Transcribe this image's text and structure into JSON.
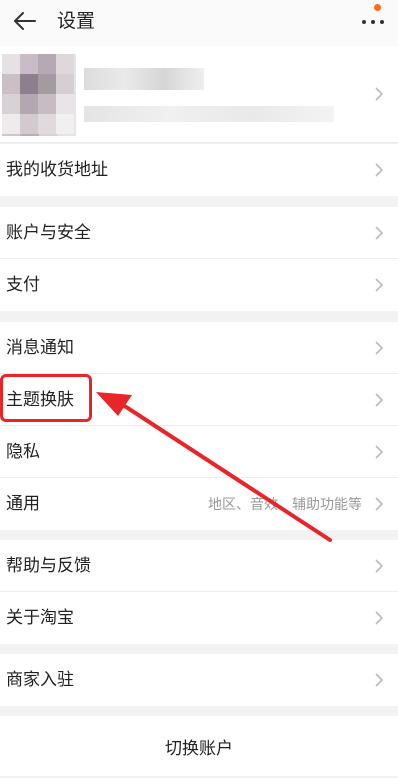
{
  "header": {
    "back_icon": "arrow-left-icon",
    "title": "设置",
    "more_icon": "more-dots-icon",
    "badge_color": "#ff6a1a"
  },
  "profile": {
    "avatar": "pixelated-avatar",
    "chevron_icon": "chevron-right-icon"
  },
  "groups": [
    {
      "items": [
        {
          "label": "我的收货地址"
        }
      ]
    },
    {
      "items": [
        {
          "label": "账户与安全"
        },
        {
          "label": "支付"
        }
      ]
    },
    {
      "items": [
        {
          "label": "消息通知"
        },
        {
          "label": "主题换肤"
        },
        {
          "label": "隐私"
        },
        {
          "label": "通用",
          "hint": "地区、音效、辅助功能等"
        }
      ]
    },
    {
      "items": [
        {
          "label": "帮助与反馈"
        },
        {
          "label": "关于淘宝"
        }
      ]
    },
    {
      "items": [
        {
          "label": "商家入驻"
        }
      ]
    }
  ],
  "switch_account": "切换账户",
  "annotation": {
    "highlight_color": "#e8262a",
    "highlighted_item": "主题换肤"
  }
}
